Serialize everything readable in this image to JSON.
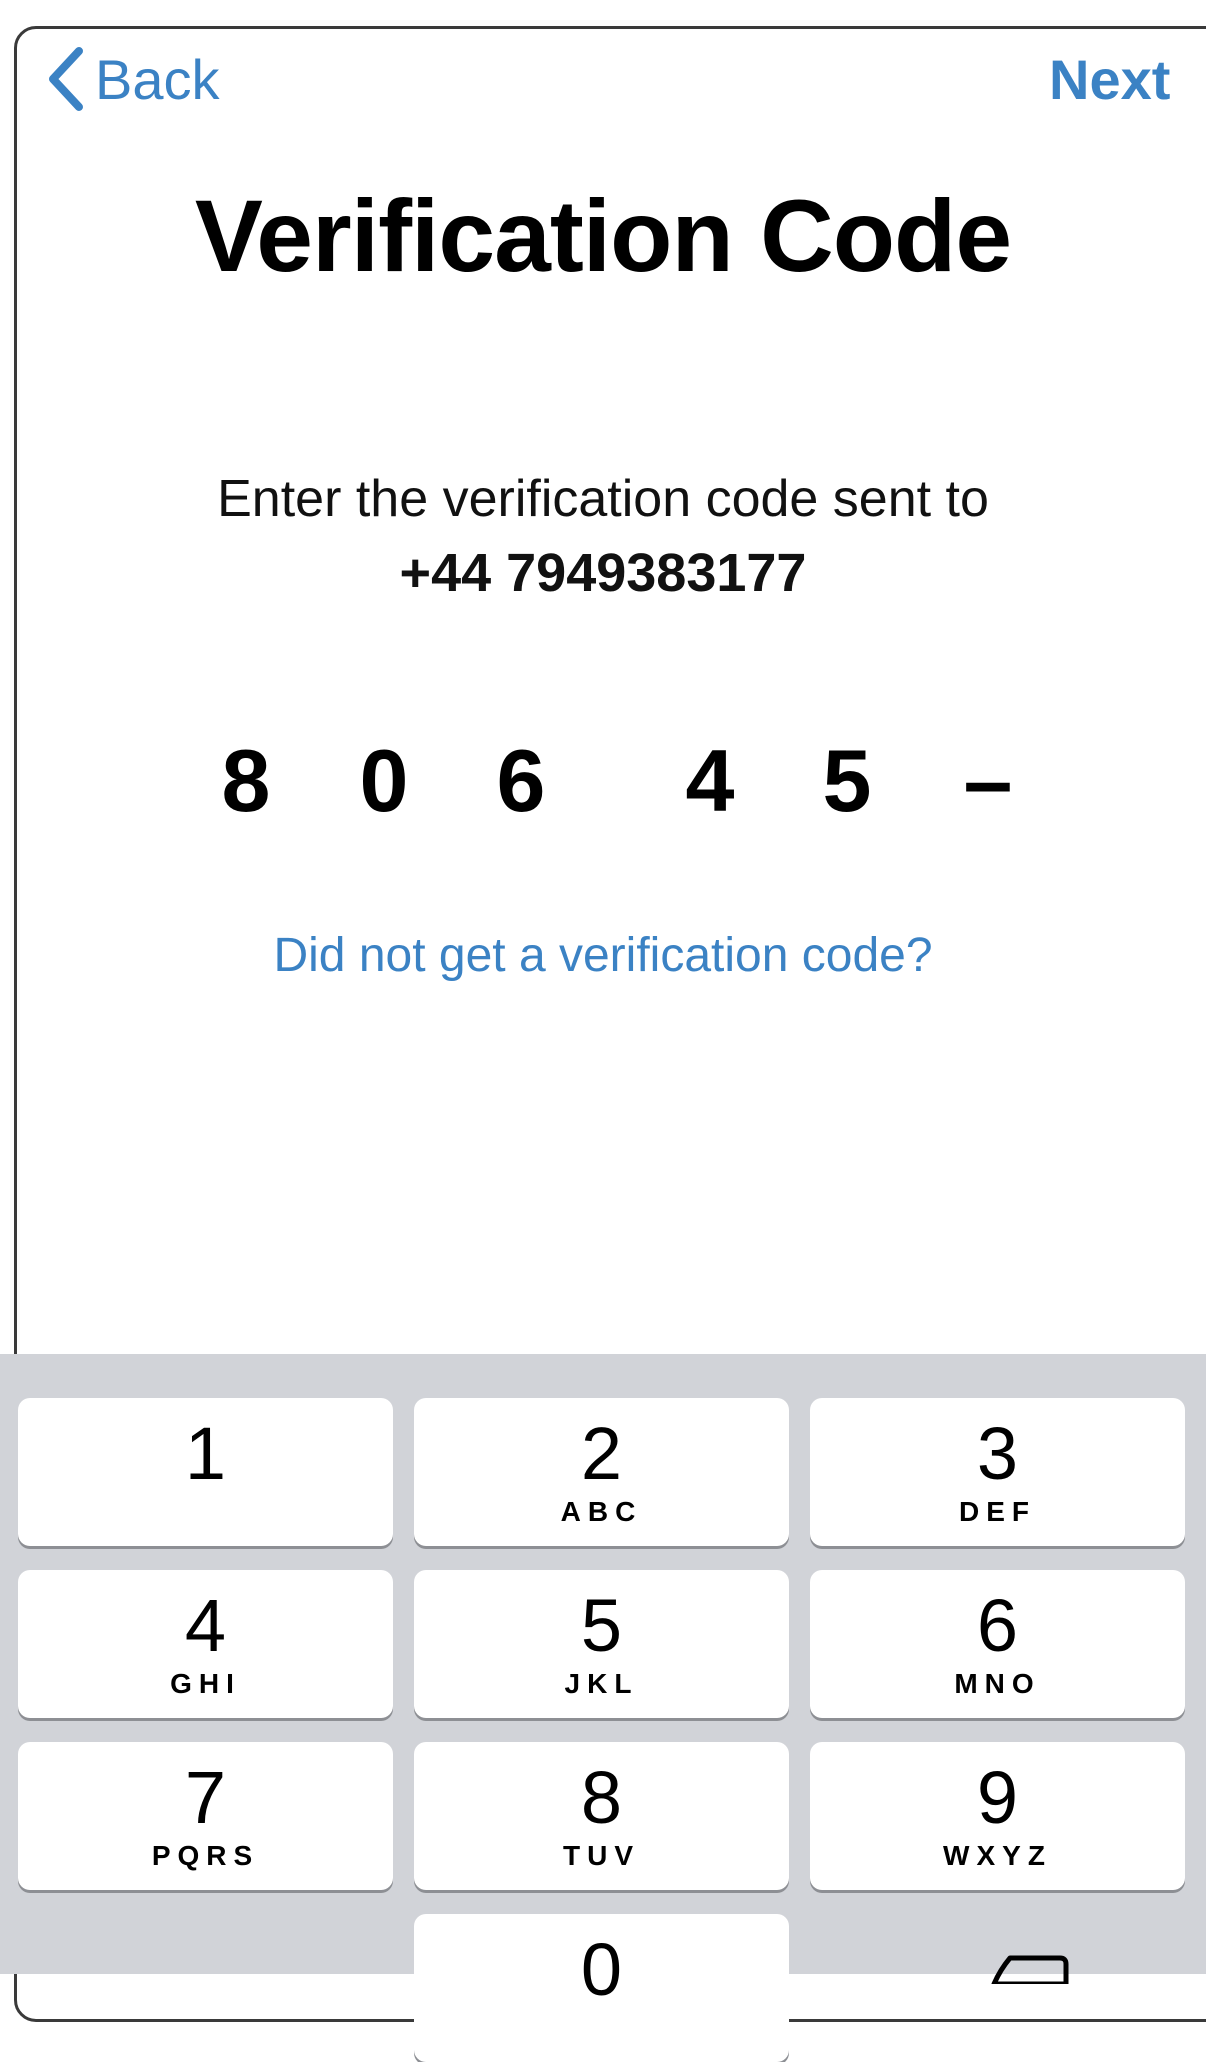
{
  "nav": {
    "back_label": "Back",
    "next_label": "Next"
  },
  "title": "Verification Code",
  "instruction": {
    "text": "Enter the verification code sent to",
    "phone": "+44 7949383177"
  },
  "code": {
    "digits": [
      "8",
      "0",
      "6",
      "4",
      "5",
      "–"
    ]
  },
  "resend_link": "Did not get a verification code?",
  "keypad": {
    "keys": [
      {
        "num": "1",
        "letters": ""
      },
      {
        "num": "2",
        "letters": "ABC"
      },
      {
        "num": "3",
        "letters": "DEF"
      },
      {
        "num": "4",
        "letters": "GHI"
      },
      {
        "num": "5",
        "letters": "JKL"
      },
      {
        "num": "6",
        "letters": "MNO"
      },
      {
        "num": "7",
        "letters": "PQRS"
      },
      {
        "num": "8",
        "letters": "TUV"
      },
      {
        "num": "9",
        "letters": "WXYZ"
      },
      {
        "num": "0",
        "letters": ""
      }
    ]
  },
  "colors": {
    "accent": "#3b82c4",
    "keypad_bg": "#d1d3d8",
    "key_bg": "#ffffff"
  },
  "icons": {
    "back": "chevron-left-icon",
    "delete": "backspace-icon"
  }
}
